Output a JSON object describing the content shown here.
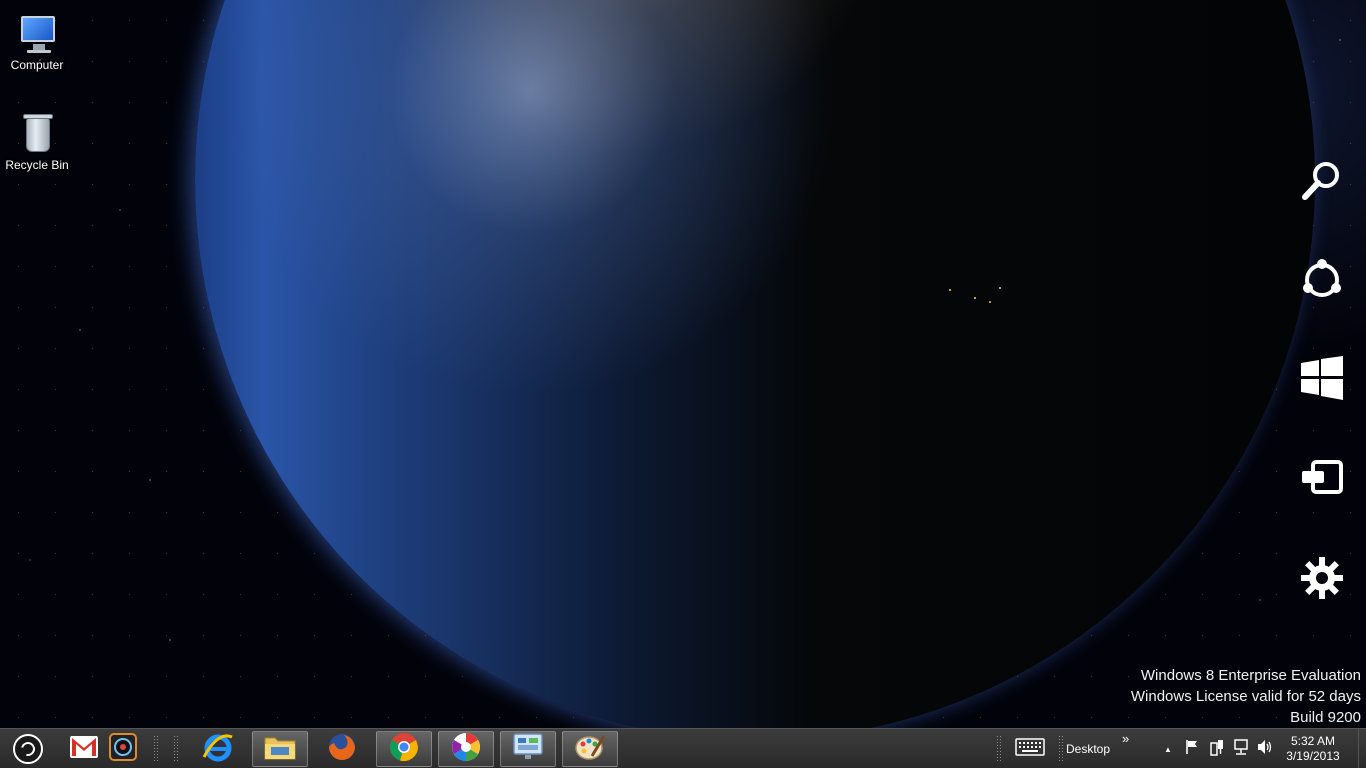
{
  "desktop": {
    "icons": [
      {
        "label": "Computer",
        "icon": "computer-icon"
      },
      {
        "label": "Recycle Bin",
        "icon": "recycle-bin-icon"
      }
    ]
  },
  "charms": [
    {
      "name": "search",
      "icon": "search-icon"
    },
    {
      "name": "share",
      "icon": "share-icon"
    },
    {
      "name": "start",
      "icon": "windows-logo-icon"
    },
    {
      "name": "devices",
      "icon": "devices-icon"
    },
    {
      "name": "settings",
      "icon": "gear-icon"
    }
  ],
  "watermark": {
    "line1": "Windows 8 Enterprise Evaluation",
    "line2": "Windows License valid for 52 days",
    "line3": "Build 9200"
  },
  "taskbar": {
    "start_icon": "start-orb-icon",
    "pinned": [
      {
        "name": "gmail",
        "icon": "gmail-icon"
      },
      {
        "name": "camera",
        "icon": "camera-icon"
      },
      {
        "name": "internet-explorer",
        "icon": "internet-explorer-icon"
      },
      {
        "name": "file-explorer",
        "icon": "file-explorer-icon",
        "running": true
      },
      {
        "name": "firefox",
        "icon": "firefox-icon"
      },
      {
        "name": "chrome",
        "icon": "chrome-icon",
        "running": true
      },
      {
        "name": "picasa",
        "icon": "picasa-icon",
        "running": true
      },
      {
        "name": "control-panel",
        "icon": "control-panel-icon",
        "running": true
      },
      {
        "name": "paint",
        "icon": "paint-icon",
        "running": true
      }
    ],
    "toolbar_label": "Desktop",
    "toolbar_chevron": "»",
    "tray": {
      "show_hidden_arrow": "▲",
      "icons": [
        "keyboard-icon",
        "action-center-flag-icon",
        "power-icon",
        "network-icon",
        "volume-icon"
      ]
    },
    "clock": {
      "time": "5:32 AM",
      "date": "3/19/2013"
    }
  },
  "colors": {
    "taskbar_bg": "#2f2f2f",
    "text": "#ffffff",
    "gmail_red": "#d93025",
    "ie_blue": "#1e90ff"
  }
}
